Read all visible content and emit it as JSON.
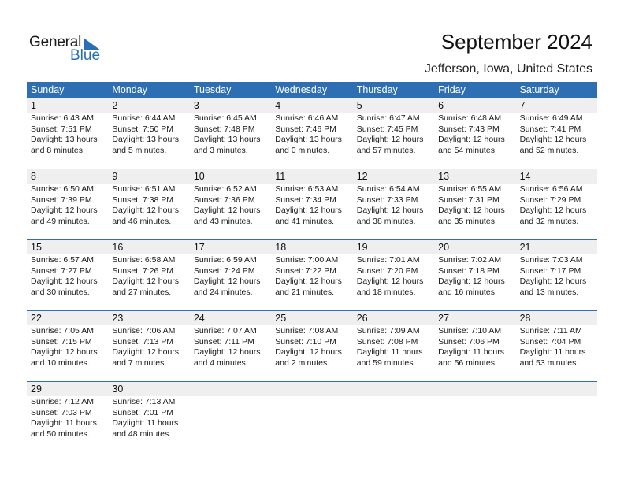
{
  "logo": {
    "general": "General",
    "blue": "Blue",
    "brand_color": "#2a6fb5"
  },
  "header": {
    "title": "September 2024",
    "location": "Jefferson, Iowa, United States"
  },
  "colors": {
    "header_bg": "#2e6eb3",
    "daynum_bg": "#efefef"
  },
  "weekdays": [
    "Sunday",
    "Monday",
    "Tuesday",
    "Wednesday",
    "Thursday",
    "Friday",
    "Saturday"
  ],
  "weeks": [
    [
      {
        "day": "1",
        "sunrise": "Sunrise: 6:43 AM",
        "sunset": "Sunset: 7:51 PM",
        "daylight1": "Daylight: 13 hours",
        "daylight2": "and 8 minutes."
      },
      {
        "day": "2",
        "sunrise": "Sunrise: 6:44 AM",
        "sunset": "Sunset: 7:50 PM",
        "daylight1": "Daylight: 13 hours",
        "daylight2": "and 5 minutes."
      },
      {
        "day": "3",
        "sunrise": "Sunrise: 6:45 AM",
        "sunset": "Sunset: 7:48 PM",
        "daylight1": "Daylight: 13 hours",
        "daylight2": "and 3 minutes."
      },
      {
        "day": "4",
        "sunrise": "Sunrise: 6:46 AM",
        "sunset": "Sunset: 7:46 PM",
        "daylight1": "Daylight: 13 hours",
        "daylight2": "and 0 minutes."
      },
      {
        "day": "5",
        "sunrise": "Sunrise: 6:47 AM",
        "sunset": "Sunset: 7:45 PM",
        "daylight1": "Daylight: 12 hours",
        "daylight2": "and 57 minutes."
      },
      {
        "day": "6",
        "sunrise": "Sunrise: 6:48 AM",
        "sunset": "Sunset: 7:43 PM",
        "daylight1": "Daylight: 12 hours",
        "daylight2": "and 54 minutes."
      },
      {
        "day": "7",
        "sunrise": "Sunrise: 6:49 AM",
        "sunset": "Sunset: 7:41 PM",
        "daylight1": "Daylight: 12 hours",
        "daylight2": "and 52 minutes."
      }
    ],
    [
      {
        "day": "8",
        "sunrise": "Sunrise: 6:50 AM",
        "sunset": "Sunset: 7:39 PM",
        "daylight1": "Daylight: 12 hours",
        "daylight2": "and 49 minutes."
      },
      {
        "day": "9",
        "sunrise": "Sunrise: 6:51 AM",
        "sunset": "Sunset: 7:38 PM",
        "daylight1": "Daylight: 12 hours",
        "daylight2": "and 46 minutes."
      },
      {
        "day": "10",
        "sunrise": "Sunrise: 6:52 AM",
        "sunset": "Sunset: 7:36 PM",
        "daylight1": "Daylight: 12 hours",
        "daylight2": "and 43 minutes."
      },
      {
        "day": "11",
        "sunrise": "Sunrise: 6:53 AM",
        "sunset": "Sunset: 7:34 PM",
        "daylight1": "Daylight: 12 hours",
        "daylight2": "and 41 minutes."
      },
      {
        "day": "12",
        "sunrise": "Sunrise: 6:54 AM",
        "sunset": "Sunset: 7:33 PM",
        "daylight1": "Daylight: 12 hours",
        "daylight2": "and 38 minutes."
      },
      {
        "day": "13",
        "sunrise": "Sunrise: 6:55 AM",
        "sunset": "Sunset: 7:31 PM",
        "daylight1": "Daylight: 12 hours",
        "daylight2": "and 35 minutes."
      },
      {
        "day": "14",
        "sunrise": "Sunrise: 6:56 AM",
        "sunset": "Sunset: 7:29 PM",
        "daylight1": "Daylight: 12 hours",
        "daylight2": "and 32 minutes."
      }
    ],
    [
      {
        "day": "15",
        "sunrise": "Sunrise: 6:57 AM",
        "sunset": "Sunset: 7:27 PM",
        "daylight1": "Daylight: 12 hours",
        "daylight2": "and 30 minutes."
      },
      {
        "day": "16",
        "sunrise": "Sunrise: 6:58 AM",
        "sunset": "Sunset: 7:26 PM",
        "daylight1": "Daylight: 12 hours",
        "daylight2": "and 27 minutes."
      },
      {
        "day": "17",
        "sunrise": "Sunrise: 6:59 AM",
        "sunset": "Sunset: 7:24 PM",
        "daylight1": "Daylight: 12 hours",
        "daylight2": "and 24 minutes."
      },
      {
        "day": "18",
        "sunrise": "Sunrise: 7:00 AM",
        "sunset": "Sunset: 7:22 PM",
        "daylight1": "Daylight: 12 hours",
        "daylight2": "and 21 minutes."
      },
      {
        "day": "19",
        "sunrise": "Sunrise: 7:01 AM",
        "sunset": "Sunset: 7:20 PM",
        "daylight1": "Daylight: 12 hours",
        "daylight2": "and 18 minutes."
      },
      {
        "day": "20",
        "sunrise": "Sunrise: 7:02 AM",
        "sunset": "Sunset: 7:18 PM",
        "daylight1": "Daylight: 12 hours",
        "daylight2": "and 16 minutes."
      },
      {
        "day": "21",
        "sunrise": "Sunrise: 7:03 AM",
        "sunset": "Sunset: 7:17 PM",
        "daylight1": "Daylight: 12 hours",
        "daylight2": "and 13 minutes."
      }
    ],
    [
      {
        "day": "22",
        "sunrise": "Sunrise: 7:05 AM",
        "sunset": "Sunset: 7:15 PM",
        "daylight1": "Daylight: 12 hours",
        "daylight2": "and 10 minutes."
      },
      {
        "day": "23",
        "sunrise": "Sunrise: 7:06 AM",
        "sunset": "Sunset: 7:13 PM",
        "daylight1": "Daylight: 12 hours",
        "daylight2": "and 7 minutes."
      },
      {
        "day": "24",
        "sunrise": "Sunrise: 7:07 AM",
        "sunset": "Sunset: 7:11 PM",
        "daylight1": "Daylight: 12 hours",
        "daylight2": "and 4 minutes."
      },
      {
        "day": "25",
        "sunrise": "Sunrise: 7:08 AM",
        "sunset": "Sunset: 7:10 PM",
        "daylight1": "Daylight: 12 hours",
        "daylight2": "and 2 minutes."
      },
      {
        "day": "26",
        "sunrise": "Sunrise: 7:09 AM",
        "sunset": "Sunset: 7:08 PM",
        "daylight1": "Daylight: 11 hours",
        "daylight2": "and 59 minutes."
      },
      {
        "day": "27",
        "sunrise": "Sunrise: 7:10 AM",
        "sunset": "Sunset: 7:06 PM",
        "daylight1": "Daylight: 11 hours",
        "daylight2": "and 56 minutes."
      },
      {
        "day": "28",
        "sunrise": "Sunrise: 7:11 AM",
        "sunset": "Sunset: 7:04 PM",
        "daylight1": "Daylight: 11 hours",
        "daylight2": "and 53 minutes."
      }
    ],
    [
      {
        "day": "29",
        "sunrise": "Sunrise: 7:12 AM",
        "sunset": "Sunset: 7:03 PM",
        "daylight1": "Daylight: 11 hours",
        "daylight2": "and 50 minutes."
      },
      {
        "day": "30",
        "sunrise": "Sunrise: 7:13 AM",
        "sunset": "Sunset: 7:01 PM",
        "daylight1": "Daylight: 11 hours",
        "daylight2": "and 48 minutes."
      },
      {
        "day": "",
        "sunrise": "",
        "sunset": "",
        "daylight1": "",
        "daylight2": ""
      },
      {
        "day": "",
        "sunrise": "",
        "sunset": "",
        "daylight1": "",
        "daylight2": ""
      },
      {
        "day": "",
        "sunrise": "",
        "sunset": "",
        "daylight1": "",
        "daylight2": ""
      },
      {
        "day": "",
        "sunrise": "",
        "sunset": "",
        "daylight1": "",
        "daylight2": ""
      },
      {
        "day": "",
        "sunrise": "",
        "sunset": "",
        "daylight1": "",
        "daylight2": ""
      }
    ]
  ]
}
